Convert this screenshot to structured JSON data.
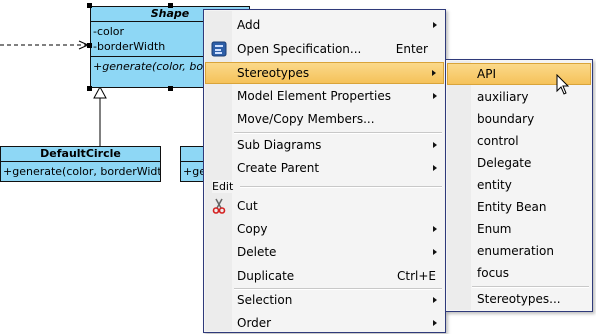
{
  "diagram": {
    "shape_class": {
      "name": "Shape",
      "attributes": [
        "-color",
        "-borderWidth"
      ],
      "operations": [
        "+generate(color, borderWidth)"
      ]
    },
    "default_circle": {
      "name": "DefaultCircle",
      "operations": [
        "+generate(color, borderWidth)"
      ]
    },
    "partial_class": {
      "operations": [
        "+gen"
      ]
    }
  },
  "context_menu": {
    "items": [
      {
        "label": "Add",
        "submenu": true
      },
      {
        "label": "Open Specification...",
        "shortcut": "Enter",
        "icon": "spec-icon"
      },
      {
        "label": "Stereotypes",
        "submenu": true,
        "highlighted": true
      },
      {
        "label": "Model Element Properties",
        "submenu": true
      },
      {
        "label": "Move/Copy Members..."
      },
      {
        "label": "Sub Diagrams",
        "submenu": true
      },
      {
        "label": "Create Parent",
        "submenu": true
      },
      {
        "label": "Cut",
        "icon": "scissors-icon"
      },
      {
        "label": "Copy",
        "submenu": true
      },
      {
        "label": "Delete",
        "submenu": true
      },
      {
        "label": "Duplicate",
        "shortcut": "Ctrl+E"
      },
      {
        "label": "Selection",
        "submenu": true
      },
      {
        "label": "Order",
        "submenu": true
      }
    ],
    "edit_group_label": "Edit"
  },
  "stereotypes_menu": {
    "items": [
      "API",
      "auxiliary",
      "boundary",
      "control",
      "Delegate",
      "entity",
      "Entity Bean",
      "Enum",
      "enumeration",
      "focus"
    ],
    "footer": "Stereotypes...",
    "highlighted": "API"
  },
  "colors": {
    "uml_fill": "#8ed7f5",
    "highlight": "#f5c25a",
    "menu_border": "#2f3a7a"
  }
}
